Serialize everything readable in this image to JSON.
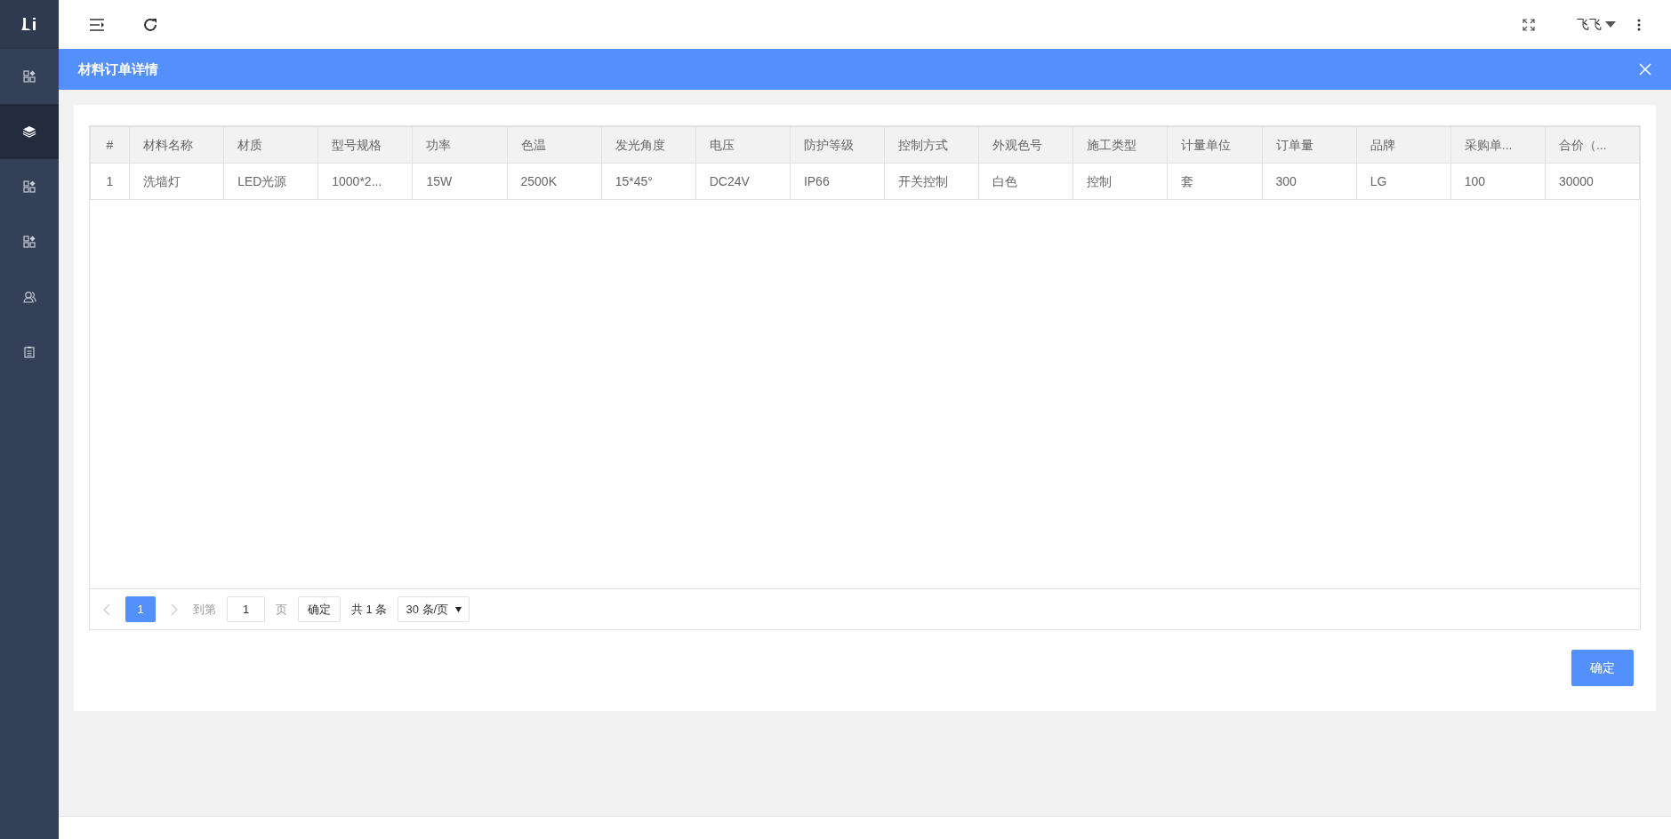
{
  "sidebar": {
    "items": [
      {
        "kind": "grid",
        "selected": false
      },
      {
        "kind": "layers",
        "selected": true
      },
      {
        "kind": "grid",
        "selected": false
      },
      {
        "kind": "grid",
        "selected": false
      },
      {
        "kind": "users",
        "selected": false
      },
      {
        "kind": "clipboard",
        "selected": false
      }
    ]
  },
  "top_bar": {
    "user_name": "飞飞"
  },
  "dialog": {
    "title": "材料订单详情",
    "table": {
      "columns": [
        "#",
        "材料名称",
        "材质",
        "型号规格",
        "功率",
        "色温",
        "发光角度",
        "电压",
        "防护等级",
        "控制方式",
        "外观色号",
        "施工类型",
        "计量单位",
        "订单量",
        "品牌",
        "采购单...",
        "合价（..."
      ],
      "rows": [
        [
          "1",
          "洗墙灯",
          "LED光源",
          "1000*2...",
          "15W",
          "2500K",
          "15*45°",
          "DC24V",
          "IP66",
          "开关控制",
          "白色",
          "控制",
          "套",
          "300",
          "LG",
          "100",
          "30000"
        ]
      ]
    },
    "pagination": {
      "pages": [
        {
          "label": "1",
          "selected": true
        }
      ],
      "goto_label": "到第",
      "goto_value": "1",
      "page_label": "页",
      "goto_button": "确定",
      "total": "共 1 条",
      "page_size": "30 条/页"
    },
    "confirm_button": "确定"
  }
}
